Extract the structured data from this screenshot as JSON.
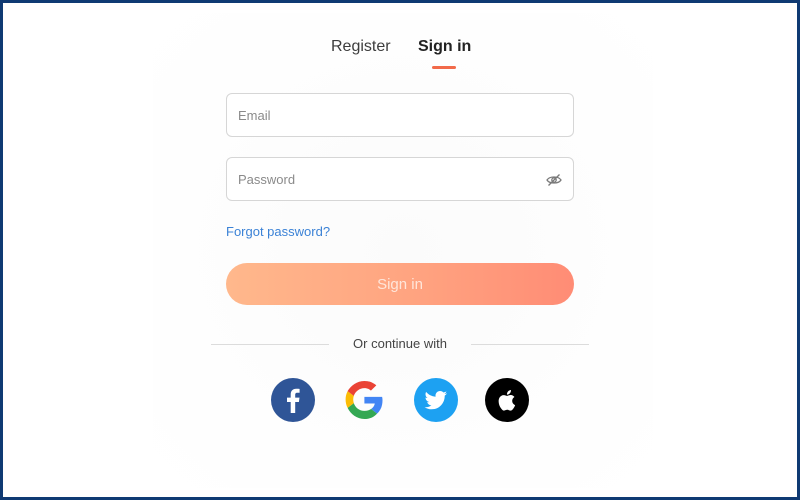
{
  "tabs": {
    "register_label": "Register",
    "signin_label": "Sign in",
    "active": "signin"
  },
  "form": {
    "email": {
      "placeholder": "Email",
      "value": ""
    },
    "password": {
      "placeholder": "Password",
      "value": ""
    },
    "forgot_label": "Forgot password?",
    "submit_label": "Sign in"
  },
  "divider": {
    "label": "Or continue with"
  },
  "social": [
    {
      "name": "facebook",
      "icon": "facebook-icon",
      "color": "#3b5998"
    },
    {
      "name": "google",
      "icon": "google-icon",
      "color": "#4285f4"
    },
    {
      "name": "twitter",
      "icon": "twitter-icon",
      "color": "#1da1f2"
    },
    {
      "name": "apple",
      "icon": "apple-icon",
      "color": "#000000"
    }
  ],
  "colors": {
    "accent": "#f26a4a",
    "link": "#3b82d6",
    "button_gradient_start": "#ffb88c",
    "button_gradient_end": "#ff8c75",
    "frame_border": "#0f3a73"
  }
}
